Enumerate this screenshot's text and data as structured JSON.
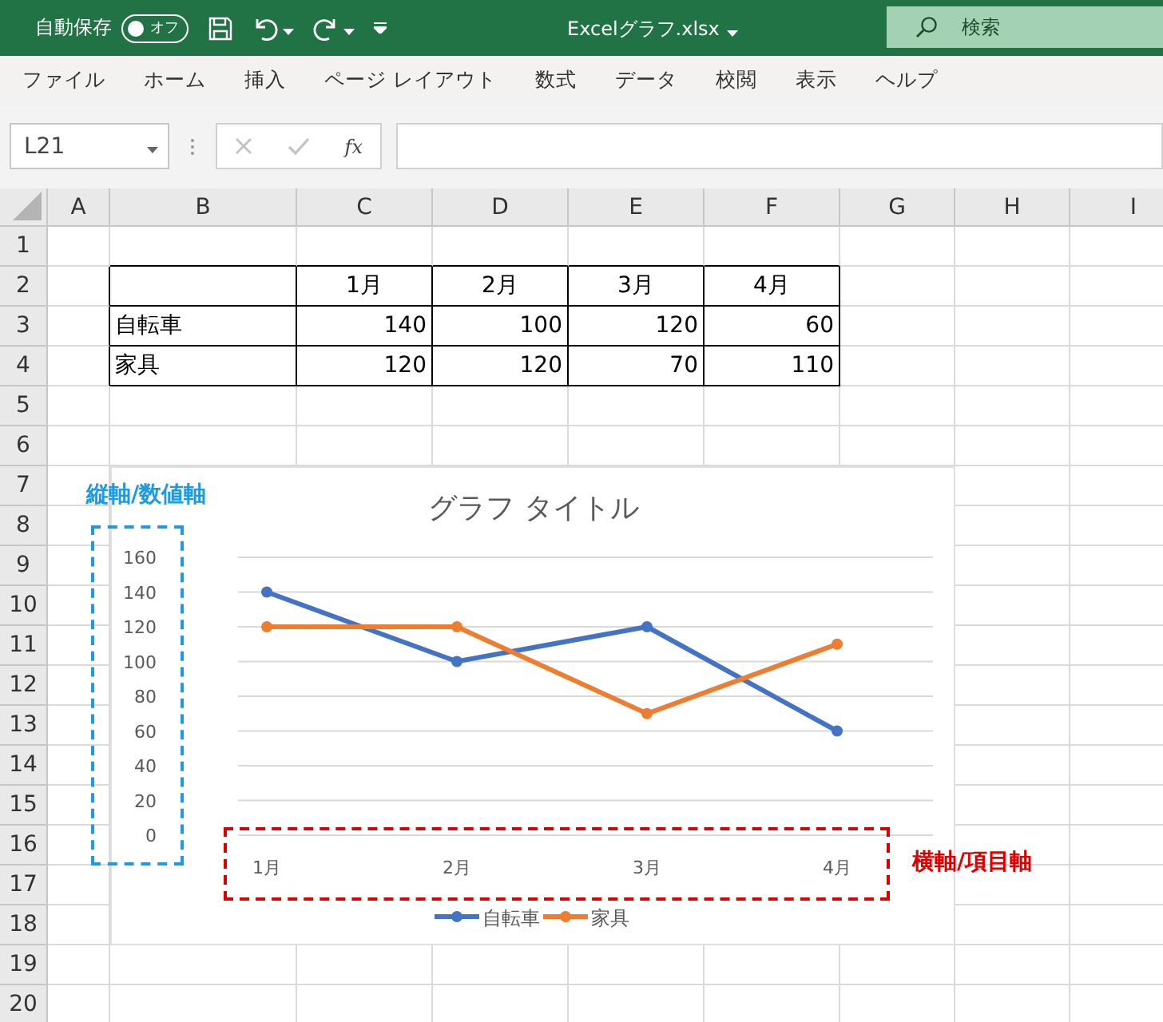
{
  "title_bar": {
    "autosave_label": "自動保存",
    "autosave": {
      "label": "オフ",
      "on": false
    },
    "file_name": "Excelグラフ.xlsx",
    "search": {
      "placeholder": "検索"
    }
  },
  "ribbon_tabs": [
    "ファイル",
    "ホーム",
    "挿入",
    "ページ レイアウト",
    "数式",
    "データ",
    "校閲",
    "表示",
    "ヘルプ"
  ],
  "formula_bar": {
    "name_box": "L21",
    "function_button": "fx"
  },
  "sheet": {
    "columns": [
      "A",
      "B",
      "C",
      "D",
      "E",
      "F",
      "G",
      "H",
      "I"
    ],
    "rows": [
      "1",
      "2",
      "3",
      "4",
      "5",
      "6",
      "7",
      "8",
      "9",
      "10",
      "11",
      "12",
      "13",
      "14",
      "15",
      "16",
      "17",
      "18",
      "19",
      "20"
    ]
  },
  "table": {
    "months": [
      "1月",
      "2月",
      "3月",
      "4月"
    ],
    "rows": [
      {
        "label": "自転車",
        "values": [
          "140",
          "100",
          "120",
          "60"
        ]
      },
      {
        "label": "家具",
        "values": [
          "120",
          "120",
          "70",
          "110"
        ]
      }
    ]
  },
  "chart": {
    "chart_data": {
      "type": "line",
      "title": "グラフ タイトル",
      "categories": [
        "1月",
        "2月",
        "3月",
        "4月"
      ],
      "series": [
        {
          "name": "自転車",
          "color": "#4472c4",
          "values": [
            140,
            100,
            120,
            60
          ],
          "marker": true
        },
        {
          "name": "家具",
          "color": "#ed7d31",
          "values": [
            120,
            120,
            70,
            110
          ],
          "marker": true
        }
      ],
      "ylim": [
        0,
        160
      ],
      "yticks": [
        0,
        20,
        40,
        60,
        80,
        100,
        120,
        140,
        160
      ],
      "grid": true,
      "legend": true
    }
  },
  "annotations": [
    {
      "kind": "vertical",
      "label": "縦軸/数値軸",
      "color": "#1e9be0"
    },
    {
      "kind": "horizontal",
      "label": "横軸/項目軸",
      "color": "#e00000"
    }
  ]
}
